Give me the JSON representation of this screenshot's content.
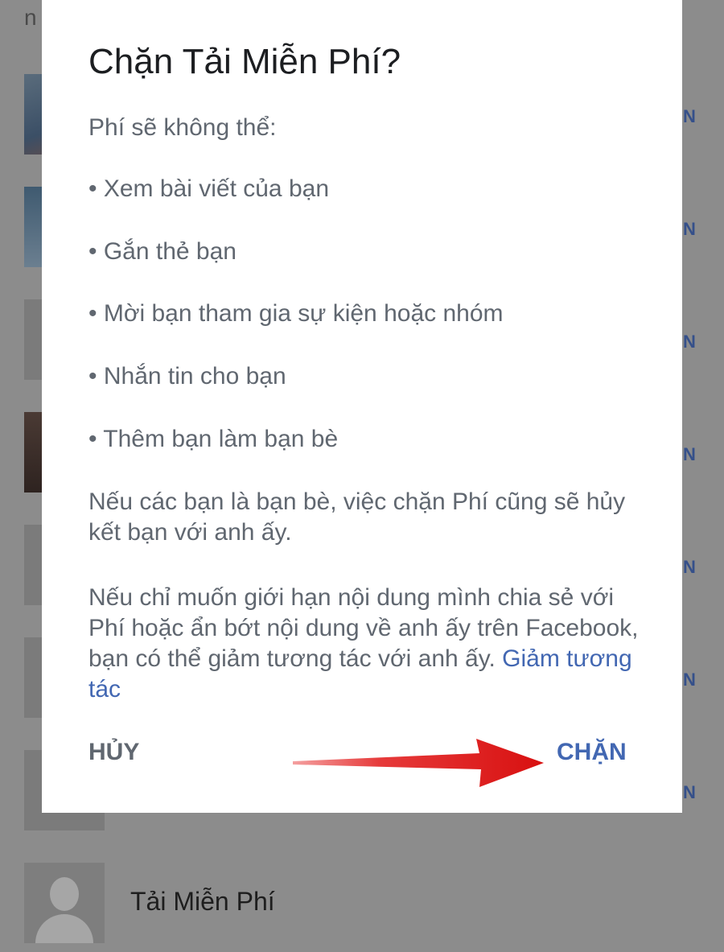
{
  "background": {
    "snippet_text": "n",
    "list_letters": [
      "N",
      "N",
      "N",
      "N",
      "N",
      "N",
      "N"
    ],
    "last_row_name": "Tải Miễn Phí"
  },
  "dialog": {
    "title": "Chặn Tải Miễn Phí?",
    "intro": "Phí sẽ không thể:",
    "bullets": [
      "• Xem bài viết của bạn",
      "• Gắn thẻ bạn",
      "• Mời bạn tham gia sự kiện hoặc nhóm",
      "• Nhắn tin cho bạn",
      "• Thêm bạn làm bạn bè"
    ],
    "paragraph1": "Nếu các bạn là bạn bè, việc chặn Phí cũng sẽ hủy kết bạn với anh ấy.",
    "paragraph2": "Nếu chỉ muốn giới hạn nội dung mình chia sẻ với Phí hoặc ẩn bớt nội dung về anh ấy trên Facebook, bạn có thể giảm tương tác với anh ấy.",
    "paragraph2_link": "Giảm tương tác",
    "cancel_label": "HỦY",
    "block_label": "CHẶN"
  },
  "colors": {
    "link": "#4267b2",
    "arrow": "#e02020"
  },
  "icons": {
    "annotation_arrow": "red-arrow-icon",
    "avatar": "default-avatar-icon"
  }
}
